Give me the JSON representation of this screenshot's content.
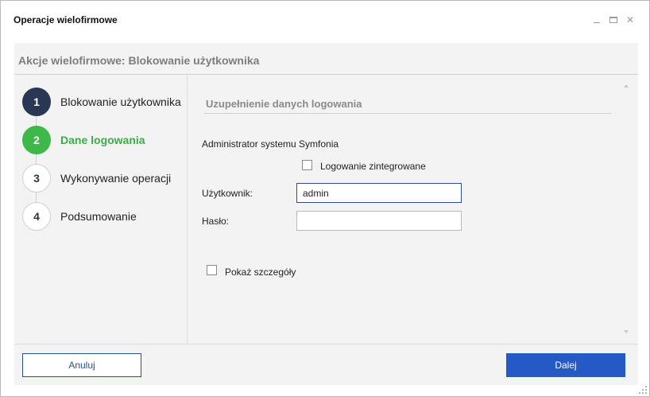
{
  "window": {
    "title": "Operacje wielofirmowe",
    "controls": {
      "minimize_icon": "minimize-icon",
      "maximize_icon": "maximize-icon",
      "close_icon": "close-icon",
      "close_glyph": "✕"
    }
  },
  "header": {
    "title": "Akcje wielofirmowe: Blokowanie użytkownika"
  },
  "steps": [
    {
      "number": "1",
      "label": "Blokowanie użytkownika",
      "state": "done"
    },
    {
      "number": "2",
      "label": "Dane logowania",
      "state": "active"
    },
    {
      "number": "3",
      "label": "Wykonywanie operacji",
      "state": "pending"
    },
    {
      "number": "4",
      "label": "Podsumowanie",
      "state": "pending"
    }
  ],
  "content": {
    "section_title": "Uzupełnienie danych logowania",
    "admin_label": "Administrator systemu Symfonia",
    "integrated_login_label": "Logowanie zintegrowane",
    "integrated_login_checked": false,
    "user_label": "Użytkownik:",
    "user_value": "admin",
    "password_label": "Hasło:",
    "password_value": "",
    "show_details_label": "Pokaż szczegóły",
    "show_details_checked": false
  },
  "footer": {
    "cancel_label": "Anuluj",
    "next_label": "Dalej"
  },
  "colors": {
    "step_done": "#293654",
    "step_active": "#3fb84a",
    "primary_button": "#2559c6",
    "panel_background": "#f3f3f3"
  }
}
